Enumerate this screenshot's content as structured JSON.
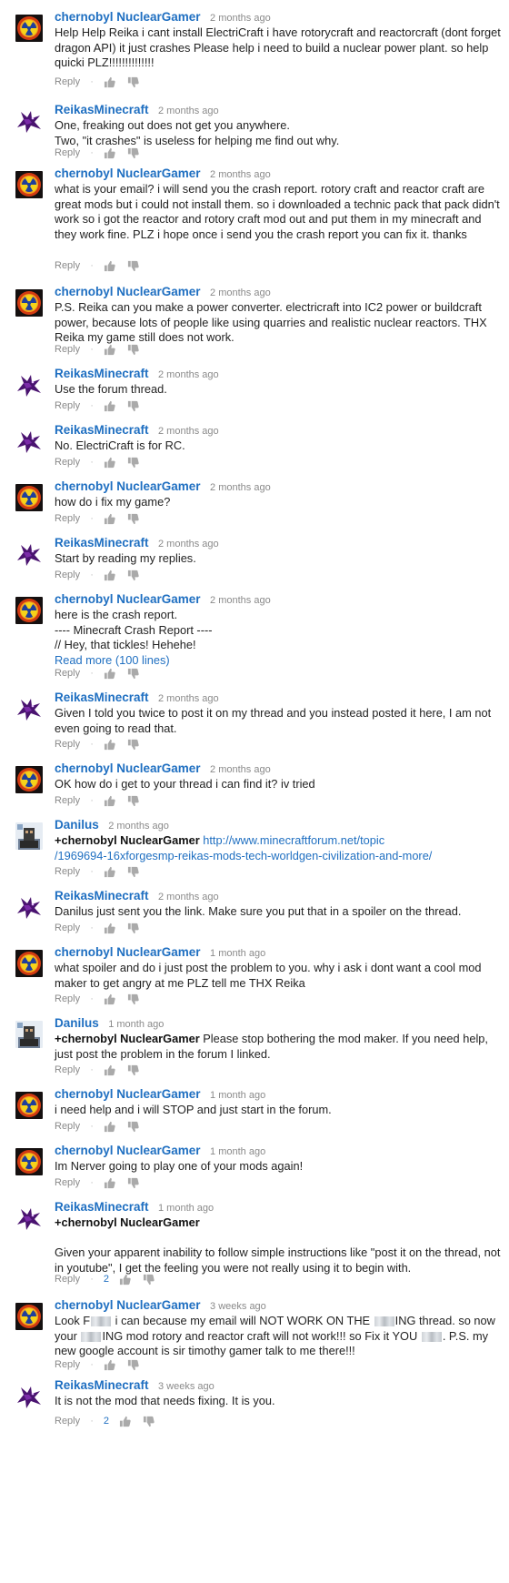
{
  "ui": {
    "reply_label": "Reply"
  },
  "colors": {
    "author_link": "#1f6fc1",
    "timestamp": "#8a8a8a",
    "accent_blue": "#1f6fc1"
  },
  "comments": [
    {
      "avatar": "chernobyl",
      "author": "chernobyl NuclearGamer",
      "time": "2 months ago",
      "text": "Help Help Reika i cant install ElectriCraft i have rotorycraft and reactorcraft (dont forget dragon API) it just crashes Please help i need to build a nuclear power plant. so help quicki PLZ!!!!!!!!!!!!!!",
      "likes": ""
    },
    {
      "avatar": "reika",
      "author": "ReikasMinecraft",
      "time": "2 months ago",
      "text": "One, freaking out does not get you anywhere.\nTwo, \"it crashes\" is useless for helping me find out why.",
      "likes": ""
    },
    {
      "avatar": "chernobyl",
      "author": "chernobyl NuclearGamer",
      "time": "2 months ago",
      "text": "what is your email? i will send you the crash report. rotory craft and reactor craft are great mods but i could not install them. so i downloaded a technic pack that pack didn't work so i got the reactor and rotory craft mod out and put them in my minecraft and they work fine. PLZ i hope once i send you the crash report you can fix it. thanks",
      "likes": ""
    },
    {
      "avatar": "chernobyl",
      "author": "chernobyl NuclearGamer",
      "time": "2 months ago",
      "text": "P.S. Reika can you make a power converter. electricraft into IC2 power or buildcraft power, because lots of people like using quarries and realistic nuclear reactors. THX Reika my game still does not work.",
      "likes": ""
    },
    {
      "avatar": "reika",
      "author": "ReikasMinecraft",
      "time": "2 months ago",
      "text": "Use the forum thread.",
      "likes": ""
    },
    {
      "avatar": "reika",
      "author": "ReikasMinecraft",
      "time": "2 months ago",
      "text": "No. ElectriCraft is for RC.",
      "likes": ""
    },
    {
      "avatar": "chernobyl",
      "author": "chernobyl NuclearGamer",
      "time": "2 months ago",
      "text": "how do i fix my game?",
      "likes": ""
    },
    {
      "avatar": "reika",
      "author": "ReikasMinecraft",
      "time": "2 months ago",
      "text": "Start by reading my replies.",
      "likes": ""
    },
    {
      "avatar": "chernobyl",
      "author": "chernobyl NuclearGamer",
      "time": "2 months ago",
      "text": "here is the crash report.\n---- Minecraft Crash Report ----\n// Hey, that tickles! Hehehe!",
      "readmore": "Read more (100 lines)",
      "likes": ""
    },
    {
      "avatar": "reika",
      "author": "ReikasMinecraft",
      "time": "2 months ago",
      "text": "Given I told you twice to post it on my thread and you instead posted it here, I am not even going to read that.",
      "likes": ""
    },
    {
      "avatar": "chernobyl",
      "author": "chernobyl NuclearGamer",
      "time": "2 months ago",
      "text": "OK how do i get to your thread i can find it? iv tried",
      "likes": ""
    },
    {
      "avatar": "danilus",
      "author": "Danilus",
      "time": "2 months ago",
      "mention": "+chernobyl NuclearGamer",
      "link": "http://www.minecraftforum.net/topic\n/1969694-16xforgesmp-reikas-mods-tech-worldgen-civilization-and-more/",
      "text": "",
      "likes": ""
    },
    {
      "avatar": "reika",
      "author": "ReikasMinecraft",
      "time": "2 months ago",
      "text": "Danilus just sent you the link. Make sure you put that in a spoiler on the thread.",
      "likes": ""
    },
    {
      "avatar": "chernobyl",
      "author": "chernobyl NuclearGamer",
      "time": "1 month ago",
      "text": "what spoiler and do i just post the  problem to you. why i ask i dont want a cool mod maker to get angry at me PLZ tell me THX Reika",
      "likes": ""
    },
    {
      "avatar": "danilus",
      "author": "Danilus",
      "time": "1 month ago",
      "mention": "+chernobyl NuclearGamer",
      "text": " Please stop bothering the mod maker. If you need help, just post the problem in the forum I linked.",
      "likes": ""
    },
    {
      "avatar": "chernobyl",
      "author": "chernobyl NuclearGamer",
      "time": "1 month ago",
      "text": "i need help and i will STOP and just start in the forum.",
      "likes": ""
    },
    {
      "avatar": "chernobyl",
      "author": "chernobyl NuclearGamer",
      "time": "1 month ago",
      "text": "Im Nerver going to play one of your mods again!",
      "likes": ""
    },
    {
      "avatar": "reika",
      "author": "ReikasMinecraft",
      "time": "1 month ago",
      "mention": "+chernobyl NuclearGamer",
      "text": "\n\nGiven your apparent inability to follow  simple instructions like \"post it on the thread, not in youtube\", I get the feeling you were not really using it to begin with.",
      "likes": "2"
    },
    {
      "avatar": "chernobyl",
      "author": "chernobyl NuclearGamer",
      "time": "3 weeks ago",
      "censored": true,
      "text_parts": [
        "Look F",
        " i can because my email will NOT WORK ON THE ",
        "ING thread. so now your ",
        "ING mod rotory and reactor craft will not work!!! so Fix it YOU ",
        ". P.S. my new google account is sir timothy gamer talk to me there!!!"
      ],
      "likes": ""
    },
    {
      "avatar": "reika",
      "author": "ReikasMinecraft",
      "time": "3 weeks ago",
      "text": "It is not the mod that needs fixing. It is you.",
      "likes": "2"
    }
  ]
}
